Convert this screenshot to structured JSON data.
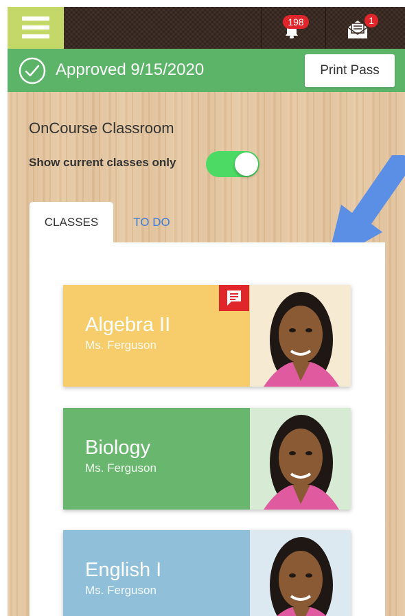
{
  "header": {
    "notifications_count": "198",
    "messages_count": "1"
  },
  "status": {
    "text": "Approved 9/15/2020",
    "print_label": "Print Pass"
  },
  "page": {
    "title": "OnCourse Classroom",
    "toggle_label": "Show current classes only",
    "toggle_on": true
  },
  "tabs": [
    {
      "label": "CLASSES",
      "active": true
    },
    {
      "label": "TO DO",
      "active": false
    }
  ],
  "classes": [
    {
      "name": "Algebra II",
      "teacher": "Ms. Ferguson",
      "color": "#f7cd6b",
      "photo_bg": "#f7ead2",
      "has_message": true
    },
    {
      "name": "Biology",
      "teacher": "Ms. Ferguson",
      "color": "#69b76e",
      "photo_bg": "#d6ead4",
      "has_message": false
    },
    {
      "name": "English I",
      "teacher": "Ms. Ferguson",
      "color": "#8fbfd9",
      "photo_bg": "#dde9f0",
      "has_message": false
    }
  ],
  "colors": {
    "menu": "#c4d86a",
    "approved_bar": "#5cb468",
    "badge": "#e0262b",
    "toggle_on": "#4cd964",
    "tab_link": "#3b7ddb",
    "arrow": "#5b8fe6"
  },
  "icons": [
    "menu-icon",
    "bell-icon",
    "mail-icon",
    "check-circle-icon",
    "message-icon",
    "arrow-icon"
  ]
}
